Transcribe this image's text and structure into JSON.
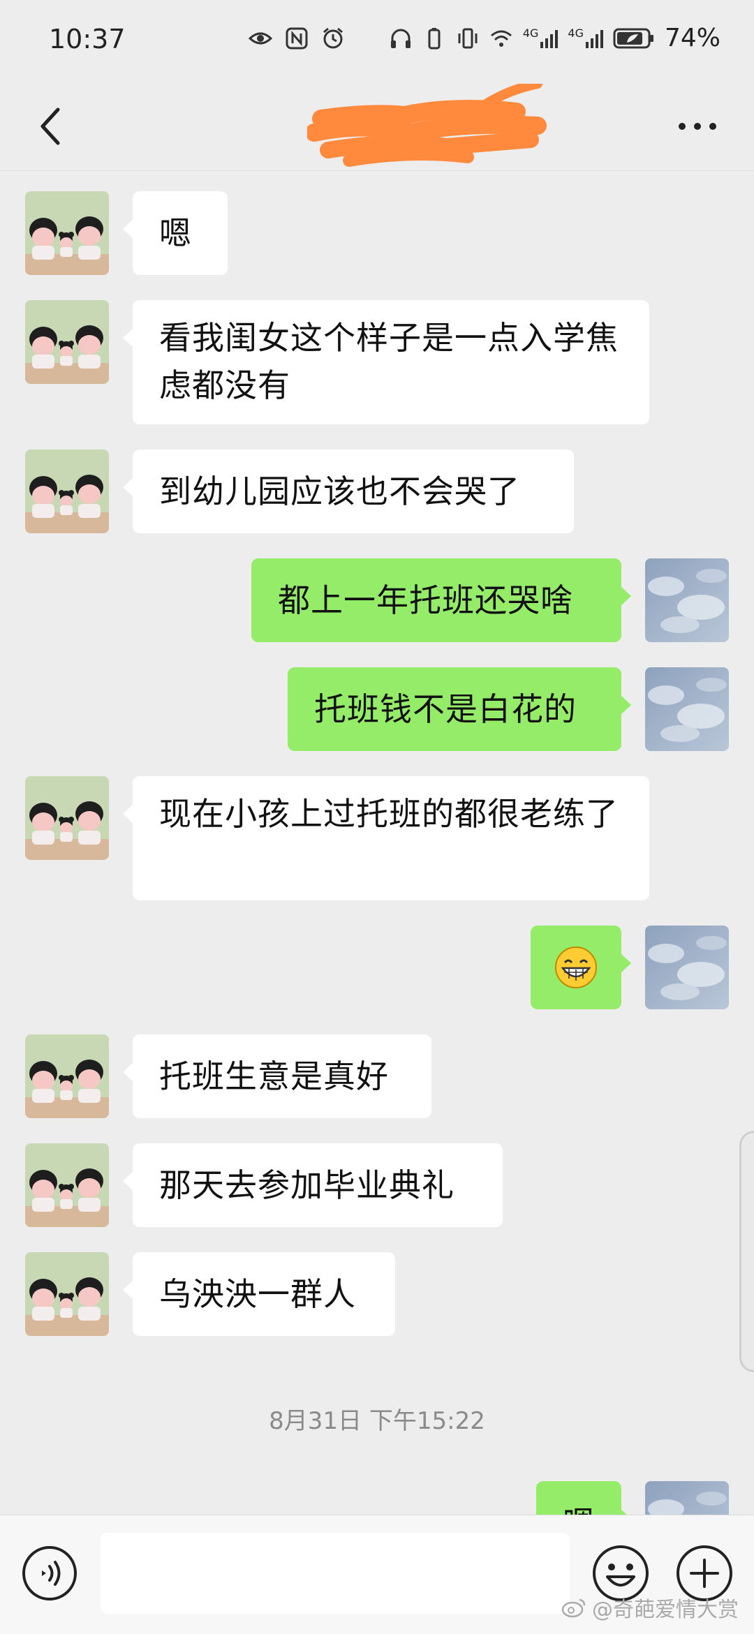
{
  "status_bar": {
    "time": "10:37",
    "network_label_1": "4G",
    "network_label_2": "4G",
    "battery_percent": "74%",
    "left_icons": [
      "eye-icon",
      "nfc-icon",
      "alarm-icon"
    ],
    "right_icons": [
      "headphones-icon",
      "battery-saver-icon",
      "vibrate-icon",
      "wifi-icon",
      "signal-icon",
      "signal-icon",
      "battery-icon"
    ]
  },
  "nav": {
    "title": "",
    "title_redacted": true,
    "back_icon": "chevron-left-icon",
    "more_icon": "more-dots-icon",
    "scribble_color": "#ff8a3d"
  },
  "messages": [
    {
      "side": "in",
      "text": "嗯"
    },
    {
      "side": "in",
      "text": "看我闺女这个样子是一点入学焦虑都没有"
    },
    {
      "side": "in",
      "text": "到幼儿园应该也不会哭了"
    },
    {
      "side": "out",
      "text": "都上一年托班还哭啥"
    },
    {
      "side": "out",
      "text": "托班钱不是白花的"
    },
    {
      "side": "in",
      "text": "现在小孩上过托班的都很老练了"
    },
    {
      "side": "out",
      "text": "😁",
      "emoji": "grinning-face-icon"
    },
    {
      "side": "in",
      "text": "托班生意是真好"
    },
    {
      "side": "in",
      "text": "那天去参加毕业典礼"
    },
    {
      "side": "in",
      "text": "乌泱泱一群人"
    },
    {
      "side": "out",
      "text": "嗯"
    }
  ],
  "timestamp": "8月31日 下午15:22",
  "input_bar": {
    "voice_icon": "voice-icon",
    "input_value": "",
    "emoji_icon": "emoji-icon",
    "plus_icon": "plus-circle-icon"
  },
  "watermark": {
    "text": "@奇葩爱情大赏",
    "icon": "weibo-icon"
  },
  "colors": {
    "background": "#ededed",
    "bubble_out": "#95ec69",
    "bubble_in": "#ffffff",
    "timestamp_text": "#8a8a8a"
  }
}
